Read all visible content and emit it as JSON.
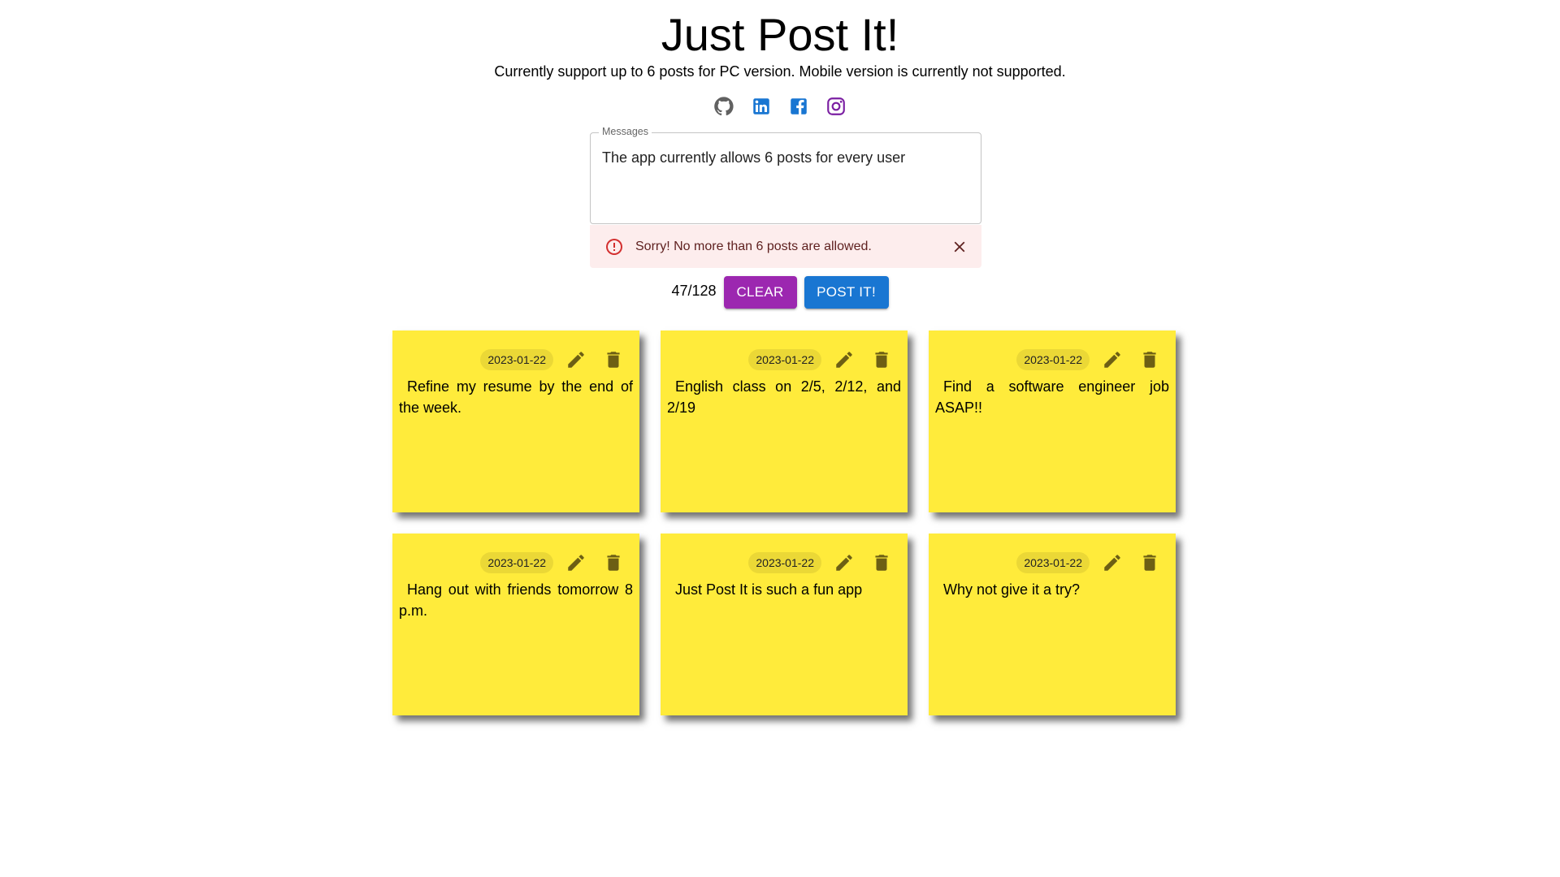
{
  "header": {
    "title": "Just Post It!",
    "subtitle": "Currently support up to 6 posts for PC version. Mobile version is currently not supported."
  },
  "socials": [
    {
      "name": "github-icon",
      "color": "#616161"
    },
    {
      "name": "linkedin-icon",
      "color": "#1976d2"
    },
    {
      "name": "facebook-icon",
      "color": "#1976d2"
    },
    {
      "name": "instagram-icon",
      "color": "#7b1fa2"
    }
  ],
  "message_field": {
    "label": "Messages",
    "value": "The app currently allows 6 posts for every user"
  },
  "alert": {
    "text": "Sorry! No more than 6 posts are allowed.",
    "icon": "error-outline-icon",
    "color": "#d32f2f"
  },
  "controls": {
    "counter": "47/128",
    "clear_label": "CLEAR",
    "post_label": "POST IT!"
  },
  "notes": [
    {
      "date": "2023-01-22",
      "text": "Refine my resume by the end of the week."
    },
    {
      "date": "2023-01-22",
      "text": "English class on 2/5, 2/12, and 2/19"
    },
    {
      "date": "2023-01-22",
      "text": "Find a software engineer job ASAP!!"
    },
    {
      "date": "2023-01-22",
      "text": "Hang out with friends tomorrow 8 p.m."
    },
    {
      "date": "2023-01-22",
      "text": "Just Post It is such a fun app"
    },
    {
      "date": "2023-01-22",
      "text": "Why not give it a try?"
    }
  ],
  "colors": {
    "note_bg": "#ffeb3b",
    "note_icon": "#6d5f14",
    "clear_button": "#9c27b0",
    "post_button": "#1976d2"
  }
}
